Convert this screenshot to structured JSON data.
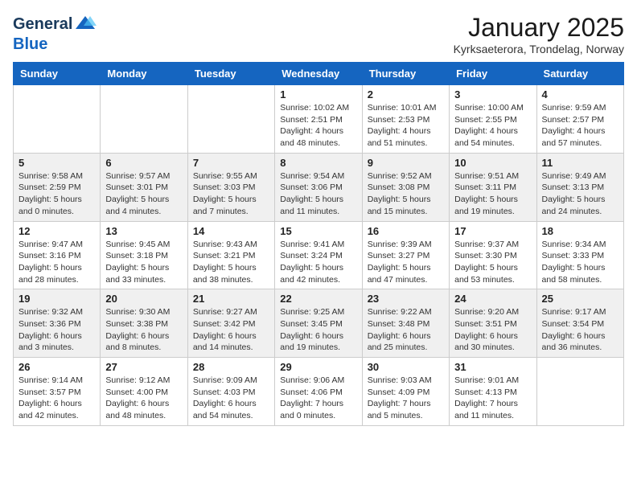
{
  "header": {
    "logo_line1": "General",
    "logo_line2": "Blue",
    "month": "January 2025",
    "location": "Kyrksaeterora, Trondelag, Norway"
  },
  "weekdays": [
    "Sunday",
    "Monday",
    "Tuesday",
    "Wednesday",
    "Thursday",
    "Friday",
    "Saturday"
  ],
  "weeks": [
    [
      {
        "day": "",
        "info": ""
      },
      {
        "day": "",
        "info": ""
      },
      {
        "day": "",
        "info": ""
      },
      {
        "day": "1",
        "info": "Sunrise: 10:02 AM\nSunset: 2:51 PM\nDaylight: 4 hours\nand 48 minutes."
      },
      {
        "day": "2",
        "info": "Sunrise: 10:01 AM\nSunset: 2:53 PM\nDaylight: 4 hours\nand 51 minutes."
      },
      {
        "day": "3",
        "info": "Sunrise: 10:00 AM\nSunset: 2:55 PM\nDaylight: 4 hours\nand 54 minutes."
      },
      {
        "day": "4",
        "info": "Sunrise: 9:59 AM\nSunset: 2:57 PM\nDaylight: 4 hours\nand 57 minutes."
      }
    ],
    [
      {
        "day": "5",
        "info": "Sunrise: 9:58 AM\nSunset: 2:59 PM\nDaylight: 5 hours\nand 0 minutes."
      },
      {
        "day": "6",
        "info": "Sunrise: 9:57 AM\nSunset: 3:01 PM\nDaylight: 5 hours\nand 4 minutes."
      },
      {
        "day": "7",
        "info": "Sunrise: 9:55 AM\nSunset: 3:03 PM\nDaylight: 5 hours\nand 7 minutes."
      },
      {
        "day": "8",
        "info": "Sunrise: 9:54 AM\nSunset: 3:06 PM\nDaylight: 5 hours\nand 11 minutes."
      },
      {
        "day": "9",
        "info": "Sunrise: 9:52 AM\nSunset: 3:08 PM\nDaylight: 5 hours\nand 15 minutes."
      },
      {
        "day": "10",
        "info": "Sunrise: 9:51 AM\nSunset: 3:11 PM\nDaylight: 5 hours\nand 19 minutes."
      },
      {
        "day": "11",
        "info": "Sunrise: 9:49 AM\nSunset: 3:13 PM\nDaylight: 5 hours\nand 24 minutes."
      }
    ],
    [
      {
        "day": "12",
        "info": "Sunrise: 9:47 AM\nSunset: 3:16 PM\nDaylight: 5 hours\nand 28 minutes."
      },
      {
        "day": "13",
        "info": "Sunrise: 9:45 AM\nSunset: 3:18 PM\nDaylight: 5 hours\nand 33 minutes."
      },
      {
        "day": "14",
        "info": "Sunrise: 9:43 AM\nSunset: 3:21 PM\nDaylight: 5 hours\nand 38 minutes."
      },
      {
        "day": "15",
        "info": "Sunrise: 9:41 AM\nSunset: 3:24 PM\nDaylight: 5 hours\nand 42 minutes."
      },
      {
        "day": "16",
        "info": "Sunrise: 9:39 AM\nSunset: 3:27 PM\nDaylight: 5 hours\nand 47 minutes."
      },
      {
        "day": "17",
        "info": "Sunrise: 9:37 AM\nSunset: 3:30 PM\nDaylight: 5 hours\nand 53 minutes."
      },
      {
        "day": "18",
        "info": "Sunrise: 9:34 AM\nSunset: 3:33 PM\nDaylight: 5 hours\nand 58 minutes."
      }
    ],
    [
      {
        "day": "19",
        "info": "Sunrise: 9:32 AM\nSunset: 3:36 PM\nDaylight: 6 hours\nand 3 minutes."
      },
      {
        "day": "20",
        "info": "Sunrise: 9:30 AM\nSunset: 3:38 PM\nDaylight: 6 hours\nand 8 minutes."
      },
      {
        "day": "21",
        "info": "Sunrise: 9:27 AM\nSunset: 3:42 PM\nDaylight: 6 hours\nand 14 minutes."
      },
      {
        "day": "22",
        "info": "Sunrise: 9:25 AM\nSunset: 3:45 PM\nDaylight: 6 hours\nand 19 minutes."
      },
      {
        "day": "23",
        "info": "Sunrise: 9:22 AM\nSunset: 3:48 PM\nDaylight: 6 hours\nand 25 minutes."
      },
      {
        "day": "24",
        "info": "Sunrise: 9:20 AM\nSunset: 3:51 PM\nDaylight: 6 hours\nand 30 minutes."
      },
      {
        "day": "25",
        "info": "Sunrise: 9:17 AM\nSunset: 3:54 PM\nDaylight: 6 hours\nand 36 minutes."
      }
    ],
    [
      {
        "day": "26",
        "info": "Sunrise: 9:14 AM\nSunset: 3:57 PM\nDaylight: 6 hours\nand 42 minutes."
      },
      {
        "day": "27",
        "info": "Sunrise: 9:12 AM\nSunset: 4:00 PM\nDaylight: 6 hours\nand 48 minutes."
      },
      {
        "day": "28",
        "info": "Sunrise: 9:09 AM\nSunset: 4:03 PM\nDaylight: 6 hours\nand 54 minutes."
      },
      {
        "day": "29",
        "info": "Sunrise: 9:06 AM\nSunset: 4:06 PM\nDaylight: 7 hours\nand 0 minutes."
      },
      {
        "day": "30",
        "info": "Sunrise: 9:03 AM\nSunset: 4:09 PM\nDaylight: 7 hours\nand 5 minutes."
      },
      {
        "day": "31",
        "info": "Sunrise: 9:01 AM\nSunset: 4:13 PM\nDaylight: 7 hours\nand 11 minutes."
      },
      {
        "day": "",
        "info": ""
      }
    ]
  ]
}
